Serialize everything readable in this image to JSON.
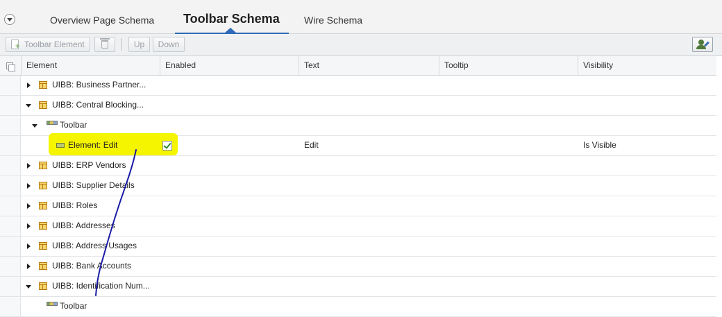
{
  "tabs": [
    {
      "label": "Overview Page Schema",
      "active": false
    },
    {
      "label": "Toolbar Schema",
      "active": true
    },
    {
      "label": "Wire Schema",
      "active": false
    }
  ],
  "toolbar": {
    "add_label": "Toolbar Element",
    "up_label": "Up",
    "down_label": "Down",
    "icons": [
      "add-document-icon",
      "trash-icon",
      "personalize-settings-icon"
    ]
  },
  "columns": [
    "Element",
    "Enabled",
    "Text",
    "Tooltip",
    "Visibility"
  ],
  "rows": [
    {
      "label": "UIBB: Business Partner...",
      "kind": "uibb",
      "state": "collapsed"
    },
    {
      "label": "UIBB: Central Blocking...",
      "kind": "uibb",
      "state": "expanded"
    },
    {
      "label": "Toolbar",
      "kind": "toolbar",
      "state": "expanded"
    },
    {
      "label": "Element: Edit",
      "kind": "element",
      "enabled": true,
      "text": "Edit",
      "visibility": "Is Visible",
      "highlighted": true
    },
    {
      "label": "UIBB: ERP Vendors",
      "kind": "uibb",
      "state": "collapsed"
    },
    {
      "label": "UIBB: Supplier Details",
      "kind": "uibb",
      "state": "collapsed"
    },
    {
      "label": "UIBB: Roles",
      "kind": "uibb",
      "state": "collapsed"
    },
    {
      "label": "UIBB: Addresses",
      "kind": "uibb",
      "state": "collapsed"
    },
    {
      "label": "UIBB: Address Usages",
      "kind": "uibb",
      "state": "collapsed"
    },
    {
      "label": "UIBB: Bank Accounts",
      "kind": "uibb",
      "state": "collapsed"
    },
    {
      "label": "UIBB: Identification Num...",
      "kind": "uibb",
      "state": "expanded"
    },
    {
      "label": "Toolbar",
      "kind": "toolbar",
      "state": "none"
    }
  ],
  "colors": {
    "highlight": "#f5f500",
    "annotation_stroke": "#1a1aa6",
    "accent": "#2f6ab8"
  }
}
